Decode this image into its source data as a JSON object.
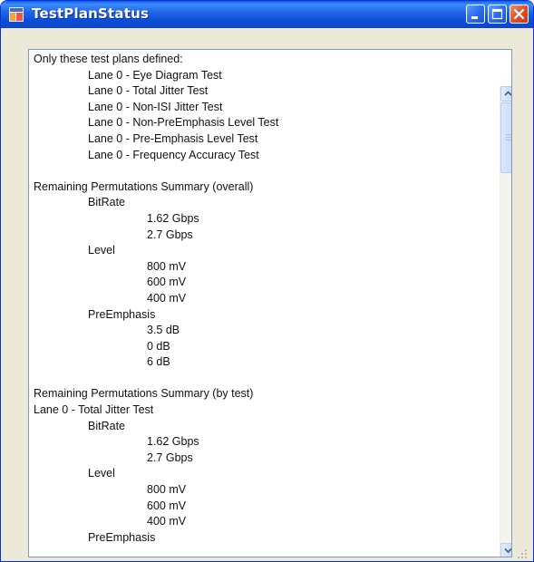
{
  "window": {
    "title": "TestPlanStatus",
    "icon": "application-icon",
    "controls": {
      "minimize": "minimize-icon",
      "maximize": "maximize-icon",
      "close": "close-icon"
    }
  },
  "textbox": {
    "lines": [
      {
        "text": "Only these test plans defined:",
        "indent": 0
      },
      {
        "text": "Lane 0 - Eye Diagram Test",
        "indent": 1
      },
      {
        "text": "Lane 0 - Total Jitter Test",
        "indent": 1
      },
      {
        "text": "Lane 0 - Non-ISI Jitter Test",
        "indent": 1
      },
      {
        "text": "Lane 0 - Non-PreEmphasis Level Test",
        "indent": 1
      },
      {
        "text": "Lane 0 - Pre-Emphasis Level Test",
        "indent": 1
      },
      {
        "text": "Lane 0 - Frequency Accuracy Test",
        "indent": 1
      },
      {
        "text": "",
        "indent": 0
      },
      {
        "text": "Remaining Permutations Summary (overall)",
        "indent": 0
      },
      {
        "text": "BitRate",
        "indent": 1
      },
      {
        "text": "1.62 Gbps",
        "indent": 2
      },
      {
        "text": "2.7 Gbps",
        "indent": 2
      },
      {
        "text": "Level",
        "indent": 1
      },
      {
        "text": "800 mV",
        "indent": 2
      },
      {
        "text": "600 mV",
        "indent": 2
      },
      {
        "text": "400 mV",
        "indent": 2
      },
      {
        "text": "PreEmphasis",
        "indent": 1
      },
      {
        "text": "3.5 dB",
        "indent": 2
      },
      {
        "text": "0 dB",
        "indent": 2
      },
      {
        "text": "6 dB",
        "indent": 2
      },
      {
        "text": "",
        "indent": 0
      },
      {
        "text": "Remaining Permutations Summary (by test)",
        "indent": 0
      },
      {
        "text": "Lane 0 - Total Jitter Test",
        "indent": 0
      },
      {
        "text": "BitRate",
        "indent": 1
      },
      {
        "text": "1.62 Gbps",
        "indent": 2
      },
      {
        "text": "2.7 Gbps",
        "indent": 2
      },
      {
        "text": "Level",
        "indent": 1
      },
      {
        "text": "800 mV",
        "indent": 2
      },
      {
        "text": "600 mV",
        "indent": 2
      },
      {
        "text": "400 mV",
        "indent": 2
      },
      {
        "text": "PreEmphasis",
        "indent": 1
      }
    ]
  },
  "scrollbar": {
    "up_icon": "chevron-up-icon",
    "down_icon": "chevron-down-icon",
    "position_fraction": 0.0
  },
  "colors": {
    "titlebar": "#0a4fd9",
    "window_bg": "#ece9d8",
    "textbox_border": "#7f9db9",
    "close_button": "#e0502a"
  }
}
